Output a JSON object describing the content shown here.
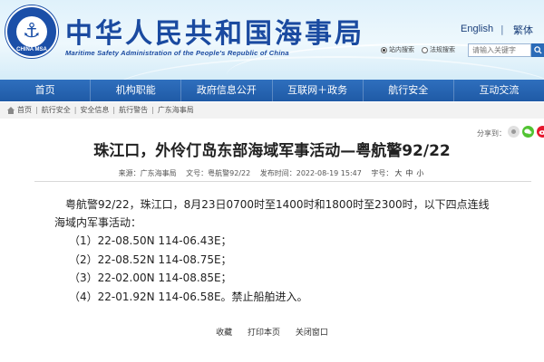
{
  "header": {
    "site_title": "中华人民共和国海事局",
    "site_subtitle": "Maritime Safety Administration of the People's Republic of China",
    "logo_text": "CHINA MSA",
    "lang_en": "English",
    "lang_sep": "|",
    "lang_tw": "繁体",
    "search": {
      "option_site": "站内搜索",
      "option_law": "法规搜索",
      "placeholder": "请输入关键字"
    }
  },
  "nav": {
    "items": [
      "首页",
      "机构职能",
      "政府信息公开",
      "互联网＋政务",
      "航行安全",
      "互动交流"
    ]
  },
  "breadcrumb": {
    "items": [
      "首页",
      "航行安全",
      "安全信息",
      "航行警告",
      "广东海事局"
    ],
    "separator": "|"
  },
  "share": {
    "label": "分享到："
  },
  "article": {
    "title": "珠江口，外伶仃岛东部海域军事活动—粤航警92/22",
    "source_label": "来源：",
    "source": "广东海事局",
    "doc_no_label": "文号：",
    "doc_no": "粤航警92/22",
    "publish_label": "发布时间：",
    "publish_time": "2022-08-19 15:47",
    "font_label": "字号：",
    "font_large": "大",
    "font_medium": "中",
    "font_small": "小",
    "para_line1": "粤航警92/22，珠江口，8月23日0700时至1400时和1800时至2300时，以下四点连线",
    "para_line2": "海域内军事活动：",
    "coords": [
      "（1）22-08.50N 114-06.43E；",
      "（2）22-08.52N 114-08.75E；",
      "（3）22-02.00N 114-08.85E；",
      "（4）22-01.92N 114-06.58E。禁止船舶进入。"
    ]
  },
  "footer": {
    "favorite": "收藏",
    "print": "打印本页",
    "close": "关闭窗口"
  }
}
